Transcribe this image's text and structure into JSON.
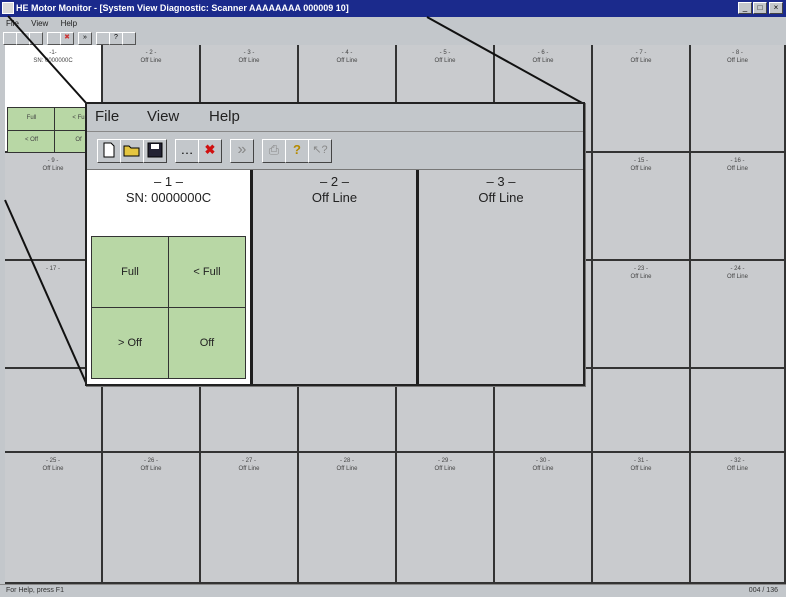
{
  "app": {
    "title": "HE Motor Monitor - [System View Diagnostic: Scanner AAAAAAAA 000009 10]",
    "menu": [
      "File",
      "View",
      "Help"
    ],
    "window_controls": [
      "_",
      "□",
      "×"
    ]
  },
  "background_grid": {
    "cells": [
      {
        "num": "-1-",
        "status": "SN: 0000000C"
      },
      {
        "num": "- 2 -",
        "status": "Off Line"
      },
      {
        "num": "- 3 -",
        "status": "Off Line"
      },
      {
        "num": "- 4 -",
        "status": "Off Line"
      },
      {
        "num": "- 5 -",
        "status": "Off Line"
      },
      {
        "num": "- 6 -",
        "status": "Off Line"
      },
      {
        "num": "- 7 -",
        "status": "Off Line"
      },
      {
        "num": "- 8 -",
        "status": "Off Line"
      },
      {
        "num": "- 9 -",
        "status": "Off Line"
      },
      {
        "num": "- 15 -",
        "status": "Off Line"
      },
      {
        "num": "- 16 -",
        "status": "Off Line"
      },
      {
        "num": "- 17 -",
        "status": "Off Line"
      },
      {
        "num": "- 23 -",
        "status": "Off Line"
      },
      {
        "num": "- 24 -",
        "status": "Off Line"
      },
      {
        "num": "- 25 -",
        "status": "Off Line"
      },
      {
        "num": "- 26 -",
        "status": "Off Line"
      },
      {
        "num": "- 27 -",
        "status": "Off Line"
      },
      {
        "num": "- 28 -",
        "status": "Off Line"
      },
      {
        "num": "- 29 -",
        "status": "Off Line"
      },
      {
        "num": "- 30 -",
        "status": "Off Line"
      },
      {
        "num": "- 31 -",
        "status": "Off Line"
      },
      {
        "num": "- 32 -",
        "status": "Off Line"
      }
    ],
    "mini_buttons": [
      "Full",
      "< Fu",
      "< Off",
      "Of"
    ]
  },
  "status_bar": {
    "left": "For Help, press F1",
    "right": "004 / 136"
  },
  "zoom": {
    "menu": [
      "File",
      "View",
      "Help"
    ],
    "toolbar": {
      "new": "🗋",
      "open": "📂",
      "save": "💾",
      "connect": "…",
      "disconnect": "✖",
      "next": "»",
      "print": "⎙",
      "about": "?",
      "context_help": "↖?"
    },
    "cells": [
      {
        "num": "– 1 –",
        "status": "SN: 0000000C"
      },
      {
        "num": "– 2 –",
        "status": "Off Line"
      },
      {
        "num": "– 3 –",
        "status": "Off Line"
      }
    ],
    "buttons": {
      "full": "Full",
      "less_full": "< Full",
      "greater_off": "> Off",
      "off": "Off"
    }
  },
  "colors": {
    "title_bar": "#1b2a8c",
    "window_bg": "#c3c7cb",
    "control_green": "#b8d7a5",
    "active_cell": "#ffffff"
  }
}
